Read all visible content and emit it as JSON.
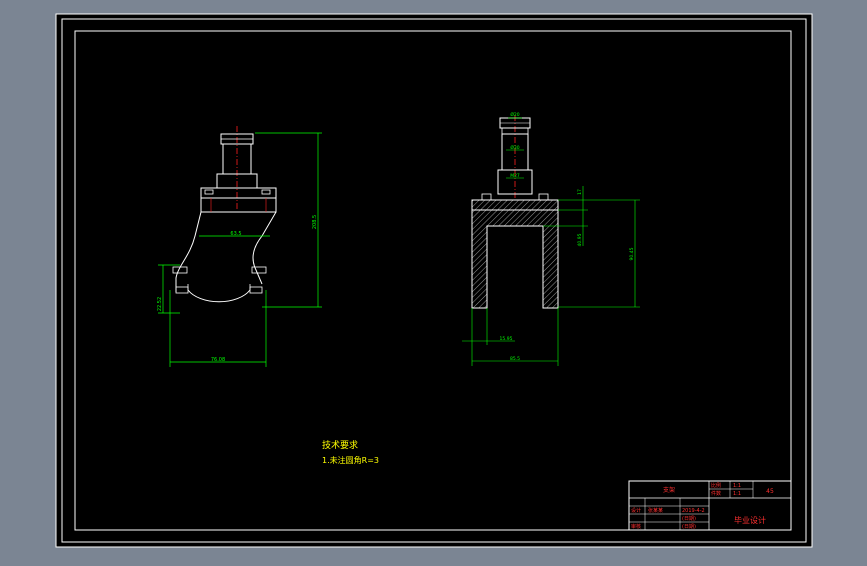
{
  "colors": {
    "viewport_bg": "#7b8593",
    "sheet_bg": "#000000",
    "frame": "#ffffff",
    "part_outline": "#ffffff",
    "dimension": "#00ff00",
    "centerline": "#ff2020",
    "hatch": "#ffffff",
    "annotation_text": "#ffff00",
    "title_block_line": "#ffffff",
    "title_block_text": "#ff3030",
    "title_block_label": "#ffff00"
  },
  "dimensions": {
    "left_view": {
      "width_mid": "63.5",
      "height_total": "208.5",
      "clamp_height": "22.52",
      "base_width": "76.08"
    },
    "right_view": {
      "shaft_top": "Ø20",
      "shaft_mid": "Ø30",
      "shaft_base": "M27",
      "flange_thk": "17",
      "slot_height": "40.95",
      "total_height": "90.45",
      "wall_thk": "15.95",
      "base_width": "85.5"
    }
  },
  "notes": {
    "title": "技术要求",
    "line1": "1.未注圆角R=3"
  },
  "title_block": {
    "r1_c1": "支架",
    "r1_scale_label": "比例",
    "r1_scale": "1:1",
    "r1_qty_label": "件数",
    "r1_sheet": "1:1",
    "r1_mat": "45",
    "r3_designer_label": "设计",
    "r3_designer": "张某某",
    "r3_date": "2019-4-2",
    "r3_review": "(日期)",
    "r4_check_label": "审核",
    "r4_date": "(日期)",
    "company": "毕业设计"
  }
}
